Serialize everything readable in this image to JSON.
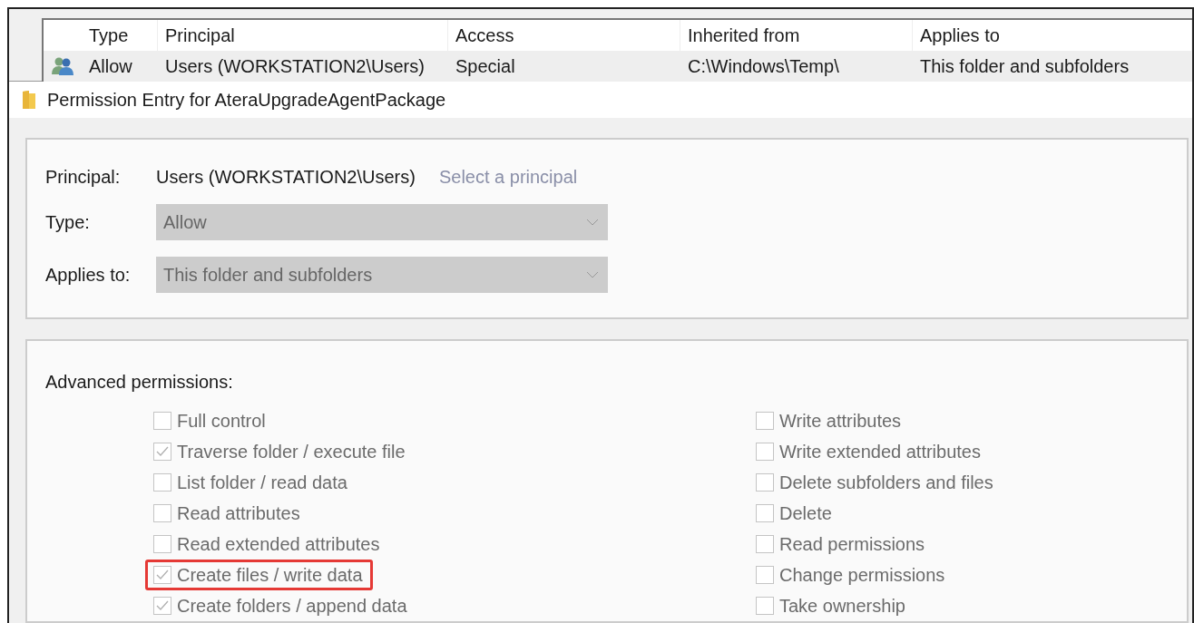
{
  "entries_table": {
    "columns": [
      "Type",
      "Principal",
      "Access",
      "Inherited from",
      "Applies to"
    ],
    "rows": [
      {
        "selected": true,
        "cells": [
          "Allow",
          "Users (WORKSTATION2\\Users)",
          "Special",
          "C:\\Windows\\Temp\\",
          "This folder and subfolders"
        ]
      }
    ]
  },
  "dialog": {
    "title": "Permission Entry for AteraUpgradeAgentPackage",
    "principal": {
      "label": "Principal:",
      "value": "Users (WORKSTATION2\\Users)",
      "link": "Select a principal"
    },
    "type": {
      "label": "Type:",
      "value": "Allow",
      "disabled": true
    },
    "applies_to": {
      "label": "Applies to:",
      "value": "This folder and subfolders",
      "disabled": true
    },
    "advanced_permissions": {
      "heading": "Advanced permissions:",
      "left": [
        {
          "label": "Full control",
          "checked": false,
          "highlighted": false
        },
        {
          "label": "Traverse folder / execute file",
          "checked": true,
          "highlighted": false
        },
        {
          "label": "List folder / read data",
          "checked": false,
          "highlighted": false
        },
        {
          "label": "Read attributes",
          "checked": false,
          "highlighted": false
        },
        {
          "label": "Read extended attributes",
          "checked": false,
          "highlighted": false
        },
        {
          "label": "Create files / write data",
          "checked": true,
          "highlighted": true
        },
        {
          "label": "Create folders / append data",
          "checked": true,
          "highlighted": false
        }
      ],
      "right": [
        {
          "label": "Write attributes",
          "checked": false,
          "highlighted": false
        },
        {
          "label": "Write extended attributes",
          "checked": false,
          "highlighted": false
        },
        {
          "label": "Delete subfolders and files",
          "checked": false,
          "highlighted": false
        },
        {
          "label": "Delete",
          "checked": false,
          "highlighted": false
        },
        {
          "label": "Read permissions",
          "checked": false,
          "highlighted": false
        },
        {
          "label": "Change permissions",
          "checked": false,
          "highlighted": false
        },
        {
          "label": "Take ownership",
          "checked": false,
          "highlighted": false
        }
      ]
    }
  }
}
